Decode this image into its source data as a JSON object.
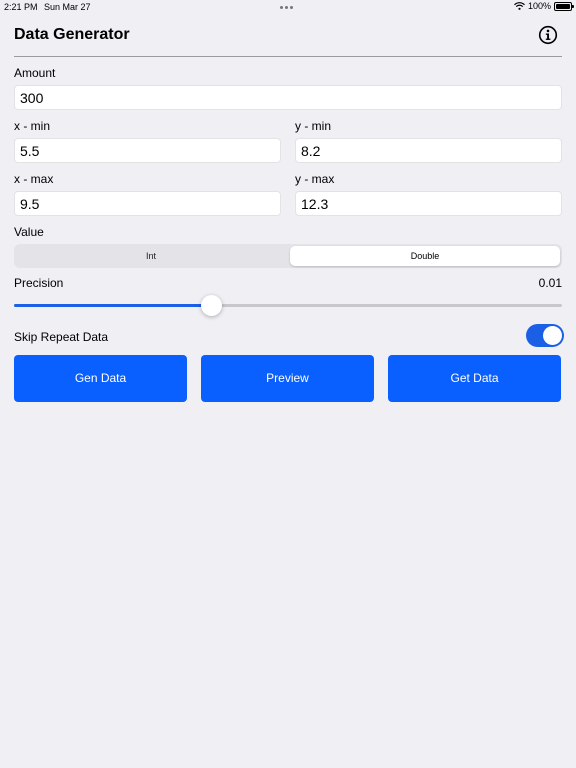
{
  "status_bar": {
    "time": "2:21 PM",
    "date": "Sun Mar 27",
    "battery": "100%"
  },
  "nav": {
    "title": "Data Generator",
    "info_icon": "info-circle-icon"
  },
  "form": {
    "amount_label": "Amount",
    "amount_value": "300",
    "x_min_label": "x - min",
    "x_min_value": "5.5",
    "y_min_label": "y - min",
    "y_min_value": "8.2",
    "x_max_label": "x - max",
    "x_max_value": "9.5",
    "y_max_label": "y - max",
    "y_max_value": "12.3",
    "value_label": "Value",
    "value_options": [
      "Int",
      "Double"
    ],
    "value_selected": "Double",
    "precision_label": "Precision",
    "precision_value": "0.01",
    "precision_slider_fraction": 0.36,
    "skip_repeat_label": "Skip Repeat Data",
    "skip_repeat_on": true
  },
  "buttons": {
    "gen_data": "Gen Data",
    "preview": "Preview",
    "get_data": "Get Data"
  },
  "colors": {
    "accent": "#0a60ff",
    "background": "#efeff4"
  }
}
